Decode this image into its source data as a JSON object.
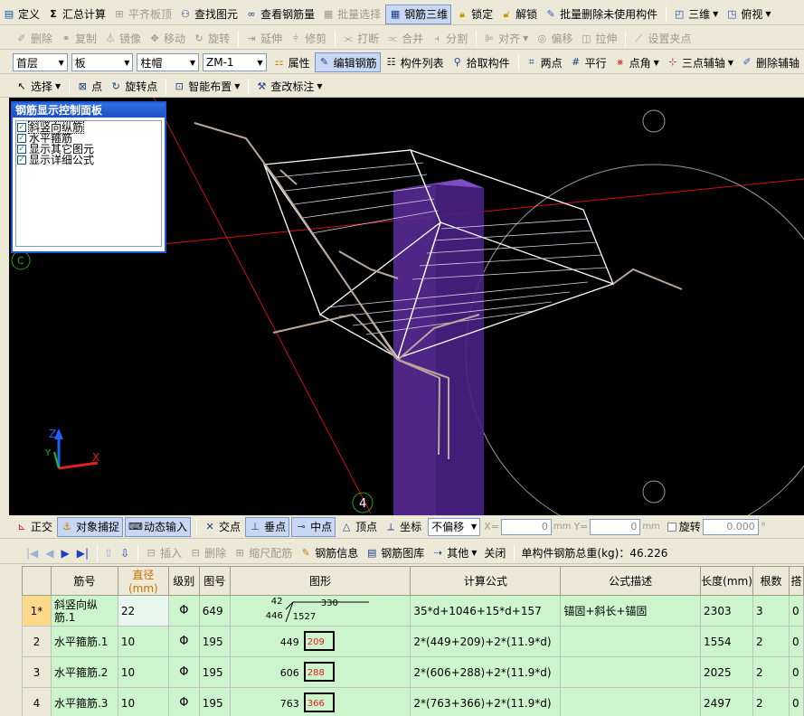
{
  "toolbar1": {
    "items": [
      {
        "label": "定义",
        "icon": "define-icon"
      },
      {
        "label": "汇总计算",
        "icon": "sigma-icon"
      },
      {
        "label": "平齐板顶",
        "icon": "align-top-icon"
      },
      {
        "label": "查找图元",
        "icon": "binoculars-icon"
      },
      {
        "label": "查看钢筋量",
        "icon": "rebar-quantity-icon"
      },
      {
        "label": "批量选择",
        "icon": "batch-select-icon"
      },
      {
        "label": "钢筋三维",
        "icon": "rebar-3d-icon"
      },
      {
        "label": "锁定",
        "icon": "lock-icon"
      },
      {
        "label": "解锁",
        "icon": "unlock-icon"
      },
      {
        "label": "批量删除未使用构件",
        "icon": "batch-delete-icon"
      },
      {
        "label": "三维",
        "icon": "cube-icon"
      },
      {
        "label": "俯视",
        "icon": "topview-icon"
      }
    ]
  },
  "toolbar2": {
    "items": [
      "删除",
      "复制",
      "镜像",
      "移动",
      "旋转",
      "延伸",
      "修剪",
      "打断",
      "合并",
      "分割",
      "对齐",
      "偏移",
      "拉伸",
      "设置夹点"
    ]
  },
  "toolbar3": {
    "floor": "首层",
    "category": "板",
    "type": "柱帽",
    "component": "ZM-1",
    "items": [
      "属性",
      "编辑钢筋",
      "构件列表",
      "拾取构件",
      "两点",
      "平行",
      "点角",
      "三点辅轴",
      "删除辅轴"
    ]
  },
  "toolbar4": {
    "items": [
      "选择",
      "点",
      "旋转点",
      "智能布置",
      "查改标注"
    ]
  },
  "panel": {
    "title": "钢筋显示控制面板",
    "options": [
      "斜竖向纵筋",
      "水平箍筋",
      "显示其它图元",
      "显示详细公式"
    ]
  },
  "viewport": {
    "axis_label_c": "C",
    "axis_label_4": "4",
    "axis_z": "Z",
    "axis_x": "X",
    "axis_y": "Y"
  },
  "snapbar": {
    "items": [
      "正交",
      "对象捕捉",
      "动态输入",
      "交点",
      "垂点",
      "中点",
      "顶点",
      "坐标"
    ],
    "offset_mode": "不偏移",
    "x_label": "X=",
    "x_value": "0",
    "y_label": "Y=",
    "y_value": "0",
    "unit": "mm",
    "rotate_label": "旋转",
    "rotate_value": "0.000",
    "degree": "°"
  },
  "tablebar": {
    "items": [
      "插入",
      "删除",
      "缩尺配筋",
      "钢筋信息",
      "钢筋图库",
      "其他",
      "关闭"
    ],
    "total_weight": "单构件钢筋总重(kg)：46.226"
  },
  "table": {
    "headers": [
      "筋号",
      "直径(mm)",
      "级别",
      "图号",
      "图形",
      "计算公式",
      "公式描述",
      "长度(mm)",
      "根数",
      "搭"
    ],
    "rows": [
      {
        "idx": "1*",
        "name": "斜竖向纵筋.1",
        "dia": "22",
        "grade": "Φ",
        "fig": "649",
        "shape": {
          "a": "42",
          "b": "330",
          "c": "446",
          "d": "1527"
        },
        "formula": "35*d+1046+15*d+157",
        "desc": "锚固+斜长+锚固",
        "len": "2303",
        "count": "3",
        "lap": "0"
      },
      {
        "idx": "2",
        "name": "水平箍筋.1",
        "dia": "10",
        "grade": "Φ",
        "fig": "195",
        "shape": {
          "a": "449",
          "b": "209"
        },
        "formula": "2*(449+209)+2*(11.9*d)",
        "desc": "",
        "len": "1554",
        "count": "2",
        "lap": "0"
      },
      {
        "idx": "3",
        "name": "水平箍筋.2",
        "dia": "10",
        "grade": "Φ",
        "fig": "195",
        "shape": {
          "a": "606",
          "b": "288"
        },
        "formula": "2*(606+288)+2*(11.9*d)",
        "desc": "",
        "len": "2025",
        "count": "2",
        "lap": "0"
      },
      {
        "idx": "4",
        "name": "水平箍筋.3",
        "dia": "10",
        "grade": "Φ",
        "fig": "195",
        "shape": {
          "a": "763",
          "b": "366"
        },
        "formula": "2*(763+366)+2*(11.9*d)",
        "desc": "",
        "len": "2497",
        "count": "2",
        "lap": "0"
      }
    ]
  }
}
